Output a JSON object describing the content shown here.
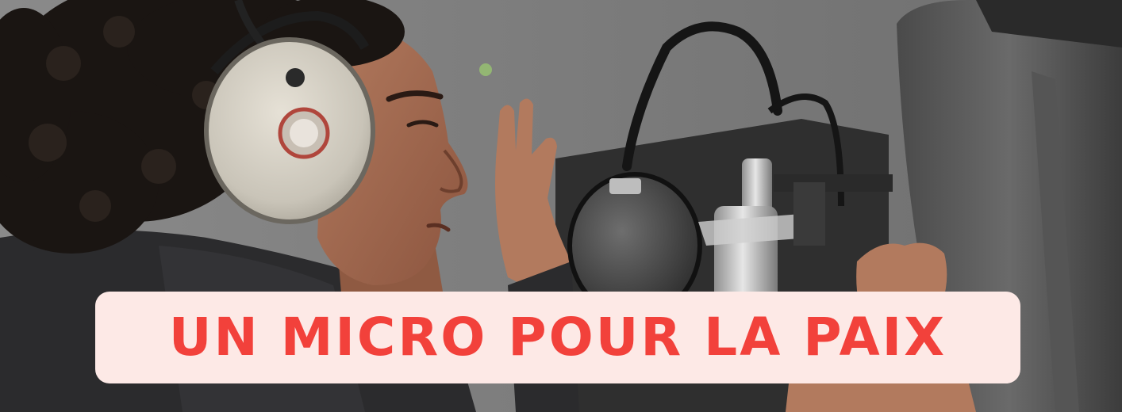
{
  "banner": {
    "title": "UN MICRO POUR LA PAIX",
    "title_color": "#f2413b",
    "pill_color": "#fde9e6"
  }
}
